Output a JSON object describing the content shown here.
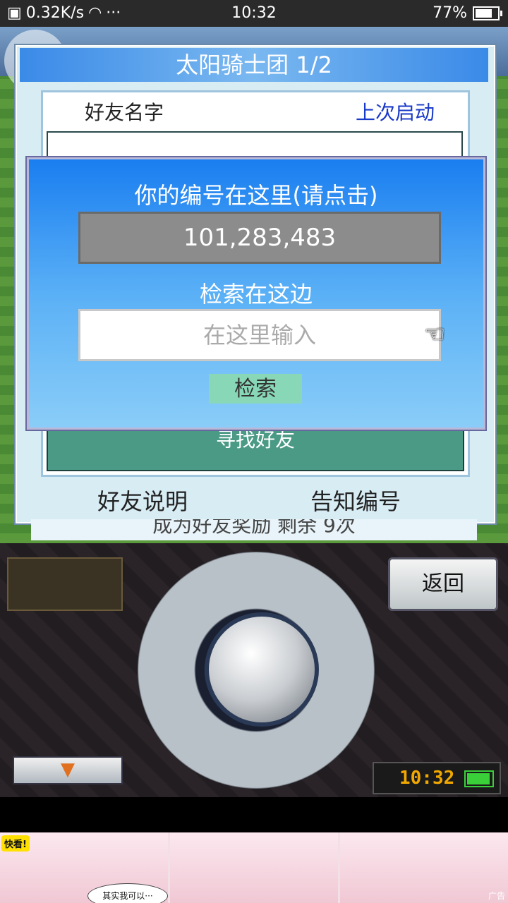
{
  "status_bar": {
    "speed": "0.32K/s",
    "dots": "···",
    "time": "10:32",
    "battery": "77%",
    "battery_level": 0.77
  },
  "dialog_window": {
    "title": "太阳骑士团 1/2",
    "col_friend_name": "好友名字",
    "col_last_launch": "上次启动",
    "find_friend_button": "寻找好友",
    "friend_help_link": "好友说明",
    "notify_id_link": "告知编号",
    "reward_banner": "成为好友奖励 剩余 9次"
  },
  "id_popup": {
    "title": "你的编号在这里(请点击)",
    "id_value": "101,283,483",
    "search_label": "检索在这边",
    "search_placeholder": "在这里输入",
    "search_button": "检索"
  },
  "controller": {
    "back_button": "返回",
    "menu_arrow": "▼",
    "clock": "10:32"
  },
  "ad": {
    "badge": "快看!",
    "bubble_text": "其实我可以···",
    "tag": "广告"
  }
}
